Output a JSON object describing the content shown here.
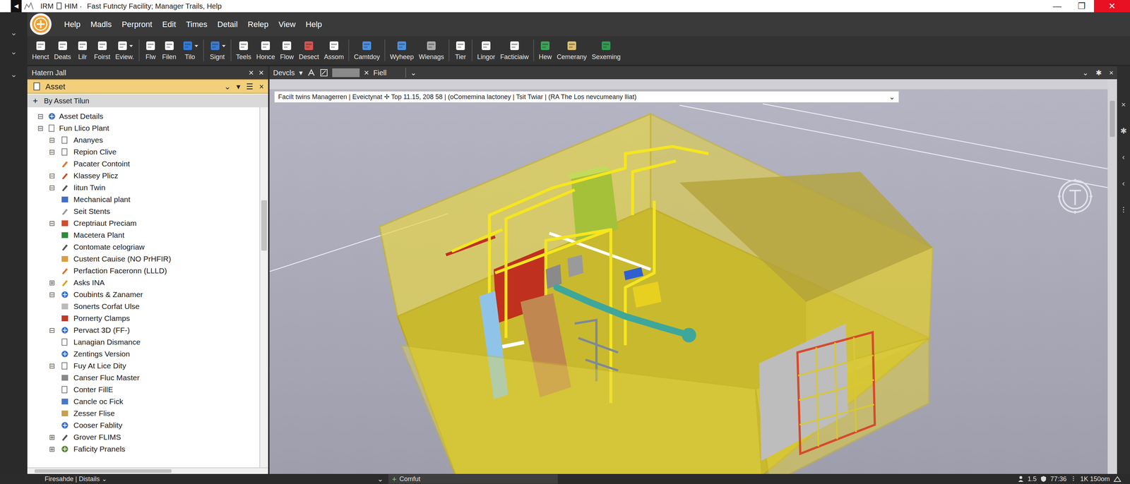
{
  "window": {
    "back": "◀",
    "title_parts": [
      "IRM",
      "HIM ·",
      "Fast Futncty Facility; Manager Trails, Help"
    ],
    "controls": [
      "—",
      "❐",
      "✕"
    ]
  },
  "menu": [
    "Help",
    "Madls",
    "Perpront",
    "Edit",
    "Times",
    "Detail",
    "Relep",
    "View",
    "Help"
  ],
  "toolbar": [
    {
      "label": "Henct",
      "color": "#ffffff",
      "dropdown": false,
      "separator": false
    },
    {
      "label": "Deats",
      "color": "#ffffff",
      "dropdown": false,
      "separator": false
    },
    {
      "label": "Lilr",
      "color": "#ffffff",
      "dropdown": false,
      "separator": false
    },
    {
      "label": "Foirst",
      "color": "#ffffff",
      "dropdown": false,
      "separator": false
    },
    {
      "label": "Eview.",
      "color": "#ffffff",
      "dropdown": true,
      "separator": true
    },
    {
      "label": "Flw",
      "color": "#ffffff",
      "dropdown": false,
      "separator": false
    },
    {
      "label": "Filen",
      "color": "#ffffff",
      "dropdown": false,
      "separator": false
    },
    {
      "label": "Tilo",
      "color": "#2f7be0",
      "dropdown": true,
      "separator": true
    },
    {
      "label": "Signt",
      "color": "#3a7bd5",
      "dropdown": true,
      "separator": true
    },
    {
      "label": "Teels",
      "color": "#ffffff",
      "dropdown": false,
      "separator": false
    },
    {
      "label": "Honce",
      "color": "#ffffff",
      "dropdown": false,
      "separator": false
    },
    {
      "label": "Flow",
      "color": "#ffffff",
      "dropdown": false,
      "separator": false
    },
    {
      "label": "Desect",
      "color": "#d9534f",
      "dropdown": false,
      "separator": false
    },
    {
      "label": "Assom",
      "color": "#ffffff",
      "dropdown": false,
      "separator": true
    },
    {
      "label": "Camtdoy",
      "color": "#4a90e2",
      "dropdown": false,
      "separator": true
    },
    {
      "label": "Wyheep",
      "color": "#4a90e2",
      "dropdown": false,
      "separator": false
    },
    {
      "label": "Wienags",
      "color": "#aaaaaa",
      "dropdown": false,
      "separator": true
    },
    {
      "label": "Tier",
      "color": "#ffffff",
      "dropdown": false,
      "separator": true
    },
    {
      "label": "Lingor",
      "color": "#ffffff",
      "dropdown": false,
      "separator": false
    },
    {
      "label": "Facticiaiw",
      "color": "#ffffff",
      "dropdown": false,
      "separator": true
    },
    {
      "label": "Hew",
      "color": "#3aa655",
      "dropdown": false,
      "separator": false
    },
    {
      "label": "Cemerany",
      "color": "#e0c070",
      "dropdown": false,
      "separator": false
    },
    {
      "label": "Sexeming",
      "color": "#2e9e4f",
      "dropdown": false,
      "separator": false
    }
  ],
  "left_rail": [
    "⌄",
    "⌄",
    "⌄"
  ],
  "panel": {
    "title": "Hatern Jall",
    "buttons": [
      "×",
      "×"
    ],
    "asset": {
      "label": "Asset",
      "controls": [
        "⌄",
        "▾",
        "☰",
        "×"
      ]
    },
    "group": {
      "icon": "+",
      "label": "By Asset Tilun"
    },
    "scroll_level": 0.3,
    "items": [
      {
        "label": "Asset Details",
        "level": 0,
        "expander": "⊟",
        "kind": "dot",
        "color": "#3f6db3"
      },
      {
        "label": "Fun Llico Plant",
        "level": 0,
        "expander": "⊟",
        "kind": "doc",
        "color": "#ffffff"
      },
      {
        "label": "Ananyes",
        "level": 1,
        "expander": "⊟",
        "kind": "doc",
        "color": "#ffffff"
      },
      {
        "label": "Repion Clive",
        "level": 1,
        "expander": "⊟",
        "kind": "doc",
        "color": "#ffffff"
      },
      {
        "label": "Pacater Contoint",
        "level": 1,
        "expander": "",
        "kind": "tool",
        "color": "#e0702a"
      },
      {
        "label": "Klassey Plicz",
        "level": 1,
        "expander": "⊟",
        "kind": "tool",
        "color": "#c8502a"
      },
      {
        "label": "Iitun Twin",
        "level": 1,
        "expander": "⊟",
        "kind": "tool",
        "color": "#555555"
      },
      {
        "label": "Mechanical plant",
        "level": 1,
        "expander": "",
        "kind": "square",
        "color": "#3f6fc8"
      },
      {
        "label": "Seit Stents",
        "level": 1,
        "expander": "",
        "kind": "tool",
        "color": "#9a9a9a"
      },
      {
        "label": "Creptriaut Preciam",
        "level": 1,
        "expander": "⊟",
        "kind": "square",
        "color": "#d24a2a"
      },
      {
        "label": "Macetera Plant",
        "level": 1,
        "expander": "",
        "kind": "square",
        "color": "#2e8b3a"
      },
      {
        "label": "Contomate celogriaw",
        "level": 1,
        "expander": "",
        "kind": "tool",
        "color": "#555555"
      },
      {
        "label": "Custent Cauise (NO PrHFIR)",
        "level": 1,
        "expander": "",
        "kind": "square",
        "color": "#d9a040"
      },
      {
        "label": "Perfaction Faceronn (LLLD)",
        "level": 1,
        "expander": "",
        "kind": "tool",
        "color": "#e0702a"
      },
      {
        "label": "Asks INA",
        "level": 1,
        "expander": "⊞",
        "kind": "tool",
        "color": "#e0a020"
      },
      {
        "label": "Coubints & Zanamer",
        "level": 1,
        "expander": "⊟",
        "kind": "dot",
        "color": "#3a6fd0"
      },
      {
        "label": "Sonerts Corfat Ulse",
        "level": 1,
        "expander": "",
        "kind": "square",
        "color": "#bbbbbb"
      },
      {
        "label": "Pornerty Clamps",
        "level": 1,
        "expander": "",
        "kind": "square",
        "color": "#c0392b"
      },
      {
        "label": "Pervact 3D (FF-)",
        "level": 1,
        "expander": "⊟",
        "kind": "dot",
        "color": "#3a6fd0"
      },
      {
        "label": "Lanagian Dismance",
        "level": 1,
        "expander": "",
        "kind": "doc",
        "color": "#ffffff"
      },
      {
        "label": "Zentings Version",
        "level": 1,
        "expander": "",
        "kind": "dot",
        "color": "#3a6fd0"
      },
      {
        "label": "Fuy At Lice Dity",
        "level": 1,
        "expander": "⊟",
        "kind": "doc",
        "color": "#ffffff"
      },
      {
        "label": "Canser Fluc Master",
        "level": 1,
        "expander": "",
        "kind": "square",
        "color": "#888888"
      },
      {
        "label": "Conter FillE",
        "level": 1,
        "expander": "",
        "kind": "doc",
        "color": "#ffffff"
      },
      {
        "label": "Cancle oc Fick",
        "level": 1,
        "expander": "",
        "kind": "square",
        "color": "#4a78c8"
      },
      {
        "label": "Zesser Flise",
        "level": 1,
        "expander": "",
        "kind": "square",
        "color": "#c8a050"
      },
      {
        "label": "Cooser Fablity",
        "level": 1,
        "expander": "",
        "kind": "dot",
        "color": "#3a6fd0"
      },
      {
        "label": "Grover FLIMS",
        "level": 1,
        "expander": "⊞",
        "kind": "tool",
        "color": "#555555"
      },
      {
        "label": "Faficity Pranels",
        "level": 1,
        "expander": "⊞",
        "kind": "dot",
        "color": "#5a8a3a"
      }
    ]
  },
  "viewport": {
    "bar": {
      "label": "Devcls",
      "arrow": "▾",
      "clear": "×",
      "field": "Fiell",
      "chevron": "⌄",
      "right": [
        "⌄",
        "✱",
        "×"
      ]
    },
    "breadcrumb": "Facilt twins Managerren | Eveictynat ✢ Top 11.15, 208 58 | (oComemina lactoney | Tsit Twiar | (RA The Los nevcumeany lliat)",
    "breadcrumb_arrow": "⌄"
  },
  "right_rail": [
    "×",
    "✱",
    "‹",
    "‹",
    "⁝"
  ],
  "status_bar": {
    "left": "Firesahde | Distails ⌄",
    "collapse": "⌄",
    "tab": {
      "icon": "+",
      "label": "Comfut"
    },
    "right": [
      "1.5",
      "77:36",
      "1K 150om"
    ]
  }
}
